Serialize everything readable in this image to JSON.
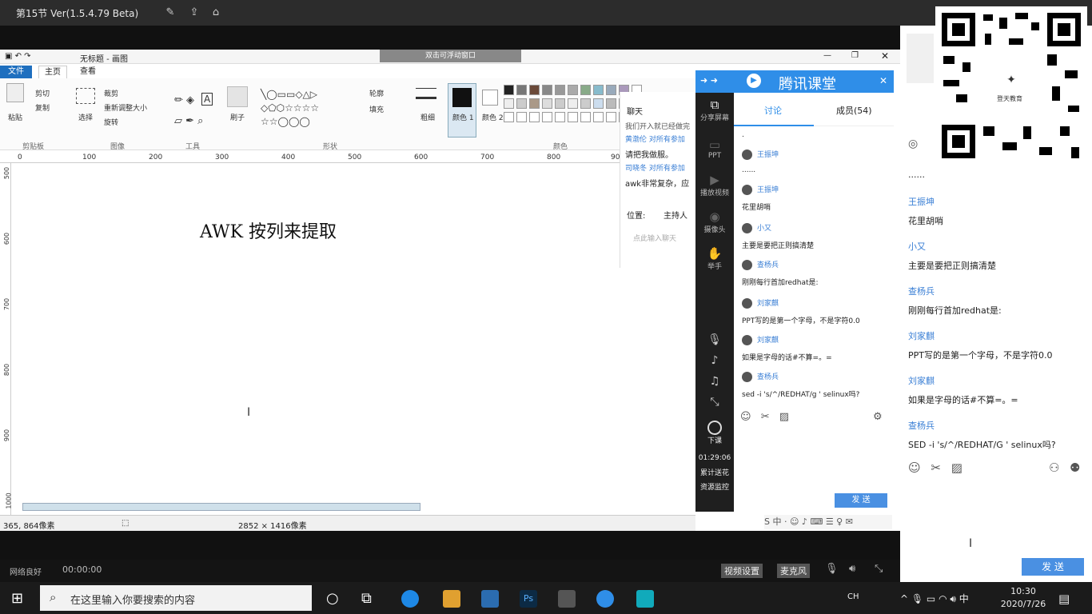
{
  "top_window": {
    "title": "第15节 Ver(1.5.4.79 Beta)"
  },
  "paint": {
    "title": "无标题 - 画图",
    "tooltip": "双击可浮动窗口",
    "menu": {
      "file": "文件",
      "home": "主页",
      "view": "查看"
    },
    "ribbon": {
      "paste": "粘贴",
      "cut": "剪切",
      "copy": "复制",
      "select": "选择",
      "crop": "裁剪",
      "resize": "重新调整大小",
      "rotate": "旋转",
      "brush": "刷子",
      "outline": "轮廓",
      "fill": "填充",
      "size": "粗细",
      "color1": "颜色 1",
      "color2": "颜色 2",
      "groups": {
        "clipboard": "剪贴板",
        "image": "图像",
        "tools": "工具",
        "shapes": "形状",
        "colors": "颜色"
      }
    },
    "ruler": [
      "0",
      "100",
      "200",
      "300",
      "400",
      "500",
      "600",
      "700",
      "800",
      "90"
    ],
    "vruler": [
      "500",
      "600",
      "700",
      "800",
      "900",
      "1000"
    ],
    "canvas_text": "AWK    按列来提取",
    "status": {
      "cursor": "365, 864像素",
      "size": "2852 × 1416像素"
    }
  },
  "side_chat": {
    "header": "聊天",
    "lines": [
      "我们开入就已经做完",
      "黄渤伦 对所有参加",
      "请把我做服。",
      "司晓冬 对所有参加",
      "awk非常复杂，应"
    ],
    "position_label": "位置:",
    "host": "主持人",
    "input_hint": "点此输入聊天"
  },
  "vtool": {
    "share": "分享屏幕",
    "ppt": "PPT",
    "video": "播放视频",
    "audio": "摄像头",
    "hand": "举手",
    "end": "下课",
    "timer": "01:29:06",
    "gift": "累计送花",
    "resource": "资源监控"
  },
  "qq": {
    "brand": "腾讯课堂",
    "tab_discuss": "讨论",
    "tab_members": "成员(54)",
    "messages": [
      {
        "name": "",
        "text": "."
      },
      {
        "name": "王振坤",
        "text": "......"
      },
      {
        "name": "王振坤",
        "text": "花里胡哨"
      },
      {
        "name": "小又",
        "text": "主要是要把正则搞清楚"
      },
      {
        "name": "查杨兵",
        "text": "刚刚每行首加redhat是:"
      },
      {
        "name": "刘家麒",
        "text": "PPT写的是第一个字母，不是字符0.0"
      },
      {
        "name": "刘家麒",
        "text": "如果是字母的话#不算=。="
      },
      {
        "name": "查杨兵",
        "text": "sed -i 's/^/REDHAT/g ' selinux吗?"
      }
    ],
    "send": "发 送"
  },
  "right_panel": {
    "messages": [
      {
        "name": "",
        "text": "......"
      },
      {
        "name": "王振坤",
        "text": "花里胡哨"
      },
      {
        "name": "小又",
        "text": "主要是要把正则搞清楚"
      },
      {
        "name": "查杨兵",
        "text": "刚刚每行首加redhat是:"
      },
      {
        "name": "刘家麒",
        "text": "PPT写的是第一个字母，不是字符0.0"
      },
      {
        "name": "刘家麒",
        "text": "如果是字母的话#不算=。="
      },
      {
        "name": "查杨兵",
        "text": "SED -i 's/^/REDHAT/G ' selinux吗?"
      }
    ],
    "send": "发 送",
    "qr_label": "登天教育"
  },
  "bottom": {
    "network": "网络良好",
    "time": "00:00:00",
    "video_settings": "视频设置",
    "mic": "麦克风"
  },
  "taskbar": {
    "search_placeholder": "在这里输入你要搜索的内容",
    "lang": "CH",
    "time": "10:30",
    "date": "2020/7/26"
  }
}
